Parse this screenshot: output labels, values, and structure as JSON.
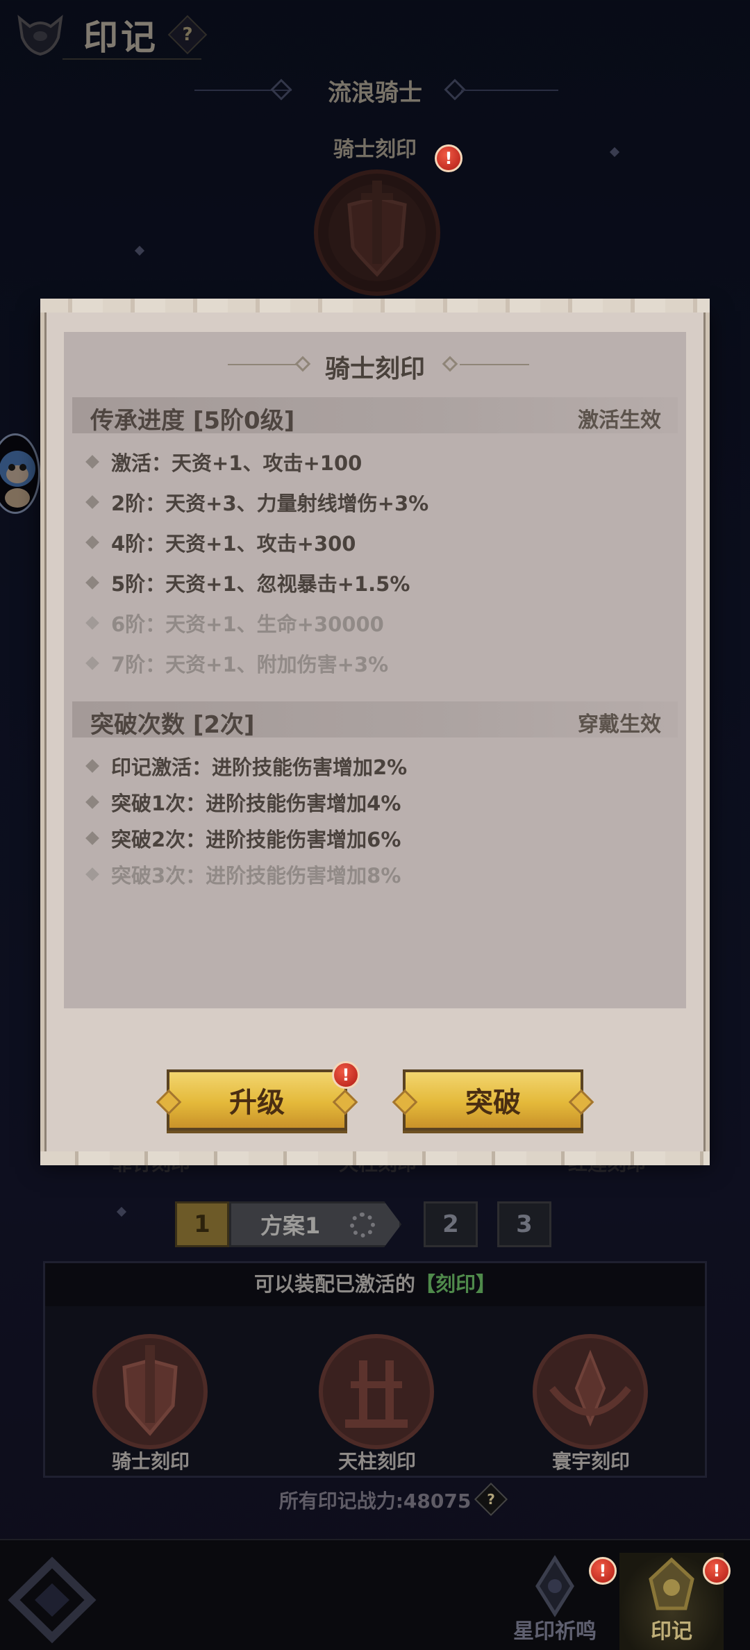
{
  "header": {
    "title": "印记",
    "help_glyph": "?"
  },
  "hero": {
    "name": "流浪骑士",
    "seal_label": "骑士刻印"
  },
  "alerts": {
    "glyph": "!"
  },
  "modal": {
    "title": "骑士刻印",
    "inherit_section": {
      "title": "传承进度 [5阶0级]",
      "status": "激活生效",
      "rows": [
        {
          "text": "激活：天资+1、攻击+100",
          "active": true
        },
        {
          "text": "2阶：天资+3、力量射线增伤+3%",
          "active": true
        },
        {
          "text": "4阶：天资+1、攻击+300",
          "active": true
        },
        {
          "text": "5阶：天资+1、忽视暴击+1.5%",
          "active": true
        },
        {
          "text": "6阶：天资+1、生命+30000",
          "active": false
        },
        {
          "text": "7阶：天资+1、附加伤害+3%",
          "active": false
        }
      ]
    },
    "break_section": {
      "title": "突破次数 [2次]",
      "status": "穿戴生效",
      "rows": [
        {
          "text": "印记激活：进阶技能伤害增加2%",
          "active": true
        },
        {
          "text": "突破1次：进阶技能伤害增加4%",
          "active": true
        },
        {
          "text": "突破2次：进阶技能伤害增加6%",
          "active": true
        },
        {
          "text": "突破3次：进阶技能伤害增加8%",
          "active": false
        }
      ]
    },
    "buttons": {
      "upgrade": "升级",
      "breakthrough": "突破"
    }
  },
  "background_seal_labels": [
    "罪钉刻印",
    "天柱刻印",
    "红莲刻印"
  ],
  "plans": {
    "active_number": "1",
    "active_label": "方案1",
    "other_numbers": [
      "2",
      "3"
    ]
  },
  "equip_panel": {
    "header_prefix": "可以装配已激活的",
    "header_highlight": "【刻印】",
    "items": [
      "骑士刻印",
      "天柱刻印",
      "寰宇刻印"
    ]
  },
  "power": {
    "label": "所有印记战力:48075",
    "help_glyph": "?"
  },
  "bottom_nav": {
    "items": [
      "星印祈鸣",
      "印记"
    ]
  }
}
